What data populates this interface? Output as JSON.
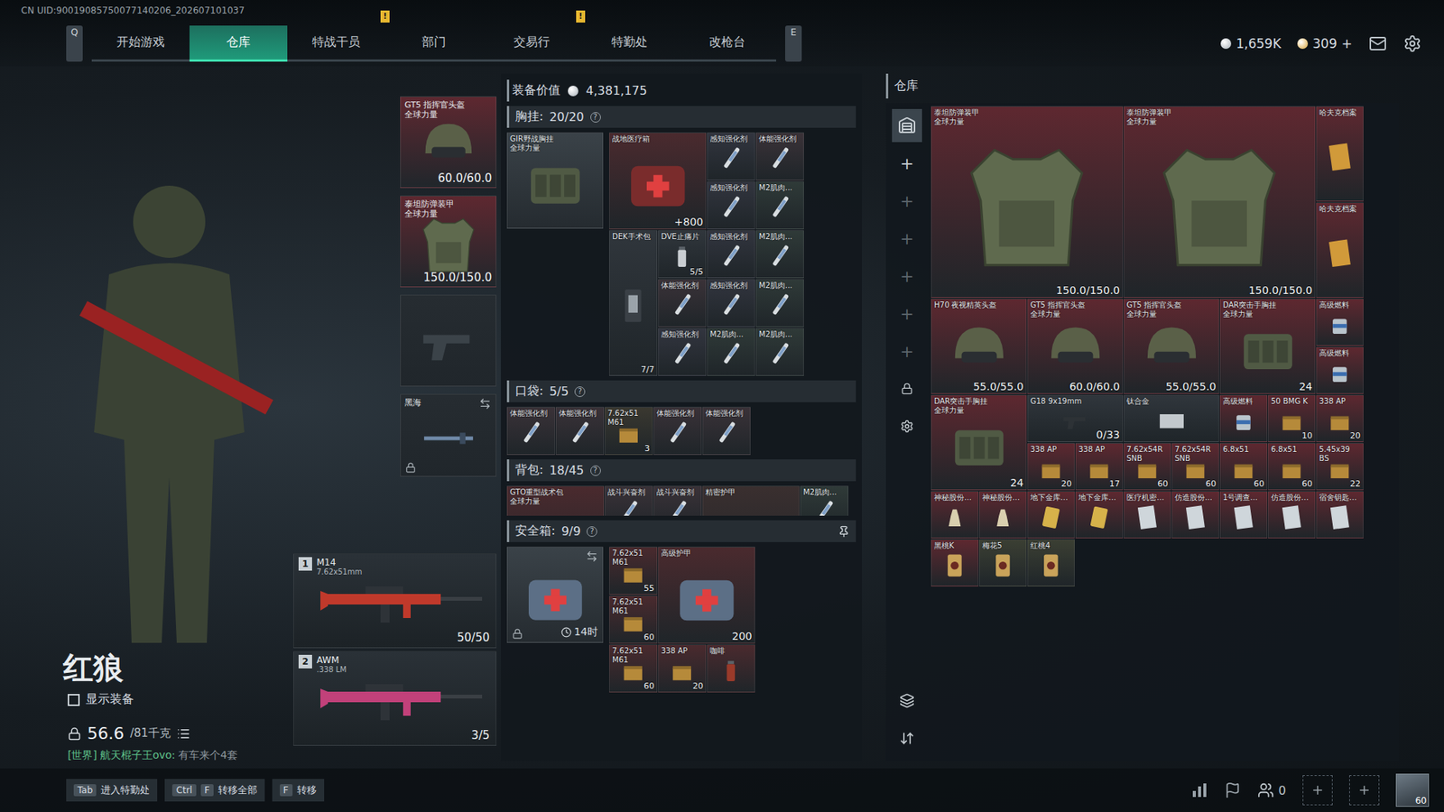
{
  "uid": "CN UID:90019085750077140206_202607101037",
  "nav": {
    "prev_key": "Q",
    "next_key": "E",
    "tabs": [
      {
        "label": "开始游戏",
        "selected": false
      },
      {
        "label": "仓库",
        "selected": true
      },
      {
        "label": "特战干员",
        "selected": false
      },
      {
        "label": "部门",
        "selected": false,
        "badge": "!"
      },
      {
        "label": "交易行",
        "selected": false
      },
      {
        "label": "特勤处",
        "selected": false,
        "badge": "!"
      },
      {
        "label": "改枪台",
        "selected": false
      }
    ]
  },
  "currency": [
    {
      "kind": "silver",
      "value": "1,659K",
      "color": "#a7b0b8"
    },
    {
      "kind": "gold",
      "value": "309",
      "action": "+",
      "color": "#d9a53a"
    }
  ],
  "operator": {
    "name": "红狼",
    "show_gear": {
      "label": "显示装备",
      "checked": false
    },
    "weight": "56.6",
    "weight_max": "/81千克",
    "chat": {
      "channel": "[世界]",
      "sender": "航天棍子王ovo:",
      "message": "有车来个4套"
    }
  },
  "equipment": {
    "slots": [
      {
        "kind": "helmet",
        "name": "GT5 指挥官头盔",
        "tag": "全球力量",
        "count": "60.0/60.0",
        "color": "#5e2830"
      },
      {
        "kind": "armor",
        "name": "泰坦防弹装甲",
        "tag": "全球力量",
        "count": "150.0/150.0",
        "color": "#5e2830"
      },
      {
        "kind": "pistol",
        "empty": true,
        "color": "#262c31"
      },
      {
        "kind": "melee",
        "name": "黑海",
        "locked": true,
        "swap": true,
        "color": "#262c31"
      }
    ],
    "weapons": [
      {
        "index": "1",
        "name": "M14",
        "caliber": "7.62x51mm",
        "ammo": "50/50",
        "color": "#c0392b"
      },
      {
        "index": "2",
        "name": "AWM",
        "caliber": ".338 LM",
        "ammo": "3/5",
        "color": "#c2417a"
      }
    ]
  },
  "loadout": {
    "value_label": "装备价值",
    "value": "4,381,175",
    "chest": {
      "title": "胸挂:",
      "count": "20/20",
      "help": "?",
      "rig": {
        "kind": "rig",
        "name": "GIR野战胸挂",
        "tag": "全球力量",
        "color": "#30363c"
      },
      "items": [
        {
          "kind": "medkit",
          "name": "战地医疗箱",
          "count": "+800",
          "color": "#4a2a2e"
        },
        {
          "kind": "injector",
          "name": "感知强化剂",
          "color": "#32353f"
        },
        {
          "kind": "injector",
          "name": "体能强化剂",
          "color": "#3a3238"
        },
        {
          "kind": "injector",
          "name": "感知强化剂",
          "color": "#32353f"
        },
        {
          "kind": "injector",
          "name": "M2肌肉...",
          "color": "#2f3a38"
        },
        {
          "kind": "surgery",
          "name": "DEK手术包",
          "count": "7/7",
          "color": "#30363c"
        },
        {
          "kind": "pills",
          "name": "DVE止痛片",
          "count": "5/5",
          "color": "#30363c"
        },
        {
          "kind": "injector",
          "name": "感知强化剂",
          "color": "#32353f"
        },
        {
          "kind": "injector",
          "name": "M2肌肉...",
          "color": "#2f3a38"
        },
        {
          "kind": "injector",
          "name": "体能强化剂",
          "color": "#3a3238"
        },
        {
          "kind": "injector",
          "name": "感知强化剂",
          "color": "#32353f"
        },
        {
          "kind": "injector",
          "name": "M2肌肉...",
          "color": "#2f3a38"
        },
        {
          "kind": "injector",
          "name": "感知强化剂",
          "color": "#32353f"
        },
        {
          "kind": "injector",
          "name": "M2肌肉...",
          "color": "#2f3a38"
        },
        {
          "kind": "injector",
          "name": "M2肌肉...",
          "color": "#2f3a38"
        }
      ]
    },
    "pocket": {
      "title": "口袋:",
      "count": "5/5",
      "help": "?",
      "items": [
        {
          "kind": "injector",
          "name": "体能强化剂",
          "color": "#3a3238"
        },
        {
          "kind": "injector",
          "name": "体能强化剂",
          "color": "#3a3238"
        },
        {
          "kind": "ammo",
          "name": "7.62x51 M61",
          "count": "3",
          "color": "#3a3830"
        },
        {
          "kind": "injector",
          "name": "体能强化剂",
          "color": "#3a3238"
        },
        {
          "kind": "injector",
          "name": "体能强化剂",
          "color": "#3a3238"
        }
      ]
    },
    "backpack": {
      "title": "背包:",
      "count": "18/45",
      "help": "?",
      "items": [
        {
          "kind": "bag",
          "name": "GTO重型战术包",
          "tag": "全球力量",
          "color": "#4a2a2e"
        },
        {
          "kind": "injector",
          "name": "战斗兴奋剂",
          "color": "#3a3238"
        },
        {
          "kind": "injector",
          "name": "战斗兴奋剂",
          "color": "#3a3238"
        },
        {
          "kind": "kit",
          "name": "精密护甲",
          "color": "#3a2f2f"
        },
        {
          "kind": "injector",
          "name": "M2肌肉...",
          "color": "#2f3a38"
        }
      ]
    },
    "safebox": {
      "title": "安全箱:",
      "count": "9/9",
      "help": "?",
      "timer": "14时",
      "locked": true,
      "items": [
        {
          "kind": "ammo",
          "name": "7.62x51 M61",
          "count": "55",
          "color": "#4a2a2e"
        },
        {
          "kind": "kit",
          "name": "高级护甲",
          "count": "200",
          "color": "#4a2a2e"
        },
        {
          "kind": "ammo",
          "name": "7.62x51 M61",
          "count": "60",
          "color": "#4a2a2e"
        },
        {
          "kind": "ammo",
          "name": "7.62x51 M61",
          "count": "60",
          "color": "#4a2a2e"
        },
        {
          "kind": "ammo",
          "name": "338 AP",
          "count": "20",
          "color": "#4a2a2e"
        },
        {
          "kind": "drink",
          "name": "咖啡",
          "color": "#4a2a2e"
        }
      ]
    }
  },
  "warehouse": {
    "title": "仓库",
    "sidebar": {
      "top": [
        {
          "kind": "warehouse",
          "selected": true
        },
        {
          "kind": "add",
          "label": "+",
          "disabled": false,
          "selected": false
        },
        {
          "kind": "add",
          "label": "+",
          "disabled": true,
          "selected": false
        },
        {
          "kind": "add",
          "label": "+",
          "disabled": true,
          "selected": false
        },
        {
          "kind": "add",
          "label": "+",
          "disabled": true,
          "selected": false
        },
        {
          "kind": "add",
          "label": "+",
          "disabled": true,
          "selected": false
        },
        {
          "kind": "add",
          "label": "+",
          "disabled": true,
          "selected": false
        },
        {
          "kind": "lock",
          "selected": false
        },
        {
          "kind": "gear",
          "selected": false
        }
      ],
      "bottom": [
        {
          "kind": "layers",
          "selected": false
        },
        {
          "kind": "sort",
          "selected": false
        }
      ]
    },
    "items": [
      {
        "kind": "armor",
        "name": "泰坦防弹装甲",
        "tag": "全球力量",
        "count": "150.0/150.0",
        "color": "#5e2830"
      },
      {
        "kind": "armor",
        "name": "泰坦防弹装甲",
        "tag": "全球力量",
        "count": "150.0/150.0",
        "color": "#5e2830"
      },
      {
        "kind": "doc",
        "name": "哈夫克档案",
        "color": "#5e2830"
      },
      {
        "kind": "doc",
        "name": "哈夫克档案",
        "color": "#5e2830"
      },
      {
        "kind": "helmet",
        "name": "H70 夜视精英头盔",
        "count": "55.0/55.0",
        "color": "#5e2830"
      },
      {
        "kind": "helmet",
        "name": "GT5 指挥官头盔",
        "tag": "全球力量",
        "count": "60.0/60.0",
        "color": "#5e2830"
      },
      {
        "kind": "helmet",
        "name": "GT5 指挥官头盔",
        "tag": "全球力量",
        "count": "55.0/55.0",
        "color": "#5e2830"
      },
      {
        "kind": "rig",
        "name": "DAR突击手胸挂",
        "tag": "全球力量",
        "count": "24",
        "color": "#5e2830"
      },
      {
        "kind": "fuel",
        "name": "高级燃料",
        "color": "#5e2830"
      },
      {
        "kind": "fuel",
        "name": "高级燃料",
        "color": "#5e2830"
      },
      {
        "kind": "rig",
        "name": "DAR突击手胸挂",
        "tag": "全球力量",
        "count": "24",
        "color": "#5e2830"
      },
      {
        "kind": "gun",
        "name": "G18 9x19mm",
        "count": "0/33",
        "color": "#30363c"
      },
      {
        "kind": "plate",
        "name": "钛合金",
        "color": "#30363c"
      },
      {
        "kind": "fuel",
        "name": "高级燃料",
        "color": "#5e2830"
      },
      {
        "kind": "ammo",
        "name": "50 BMG K",
        "count": "10",
        "color": "#5e2830"
      },
      {
        "kind": "ammo",
        "name": "338 AP",
        "count": "20",
        "color": "#5e2830"
      },
      {
        "kind": "ammo",
        "name": "338 AP",
        "count": "20",
        "color": "#5e2830"
      },
      {
        "kind": "ammo",
        "name": "338 AP",
        "count": "17",
        "color": "#5e2830"
      },
      {
        "kind": "ammo",
        "name": "7.62x54R SNB",
        "count": "60",
        "color": "#5e2830"
      },
      {
        "kind": "ammo",
        "name": "7.62x54R SNB",
        "count": "60",
        "color": "#5e2830"
      },
      {
        "kind": "ammo",
        "name": "6.8x51",
        "count": "60",
        "color": "#5e2830"
      },
      {
        "kind": "ammo",
        "name": "6.8x51",
        "count": "60",
        "color": "#5e2830"
      },
      {
        "kind": "ammo",
        "name": "5.45x39 BS",
        "count": "22",
        "color": "#5e2830"
      },
      {
        "kind": "figurine",
        "name": "神秘股份…",
        "color": "#5e2830"
      },
      {
        "kind": "figurine",
        "name": "神秘股份…",
        "color": "#5e2830"
      },
      {
        "kind": "card",
        "name": "地下金库…",
        "color": "#5e2830"
      },
      {
        "kind": "card",
        "name": "地下金库…",
        "color": "#5e2830"
      },
      {
        "kind": "paper",
        "name": "医疗机密…",
        "color": "#5e2830"
      },
      {
        "kind": "paper",
        "name": "仿造股份…",
        "color": "#5e2830"
      },
      {
        "kind": "paper",
        "name": "1号调查…",
        "color": "#5e2830"
      },
      {
        "kind": "paper",
        "name": "仿造股份…",
        "color": "#5e2830"
      },
      {
        "kind": "paper",
        "name": "宿舍钥匙…",
        "color": "#5e2830"
      },
      {
        "kind": "poker",
        "name": "黑桃K",
        "color": "#5e2830"
      },
      {
        "kind": "poker",
        "name": "梅花5",
        "color": "#3b3f33"
      },
      {
        "kind": "poker",
        "name": "红桃4",
        "color": "#3b3f33"
      }
    ]
  },
  "bottom_bar": {
    "hotkeys": [
      {
        "keys": [
          "Tab"
        ],
        "label": "进入特勤处"
      },
      {
        "keys": [
          "Ctrl",
          "F"
        ],
        "label": "转移全部"
      },
      {
        "keys": [
          "F"
        ],
        "label": "转移"
      }
    ],
    "friends": "0",
    "level": "60"
  }
}
